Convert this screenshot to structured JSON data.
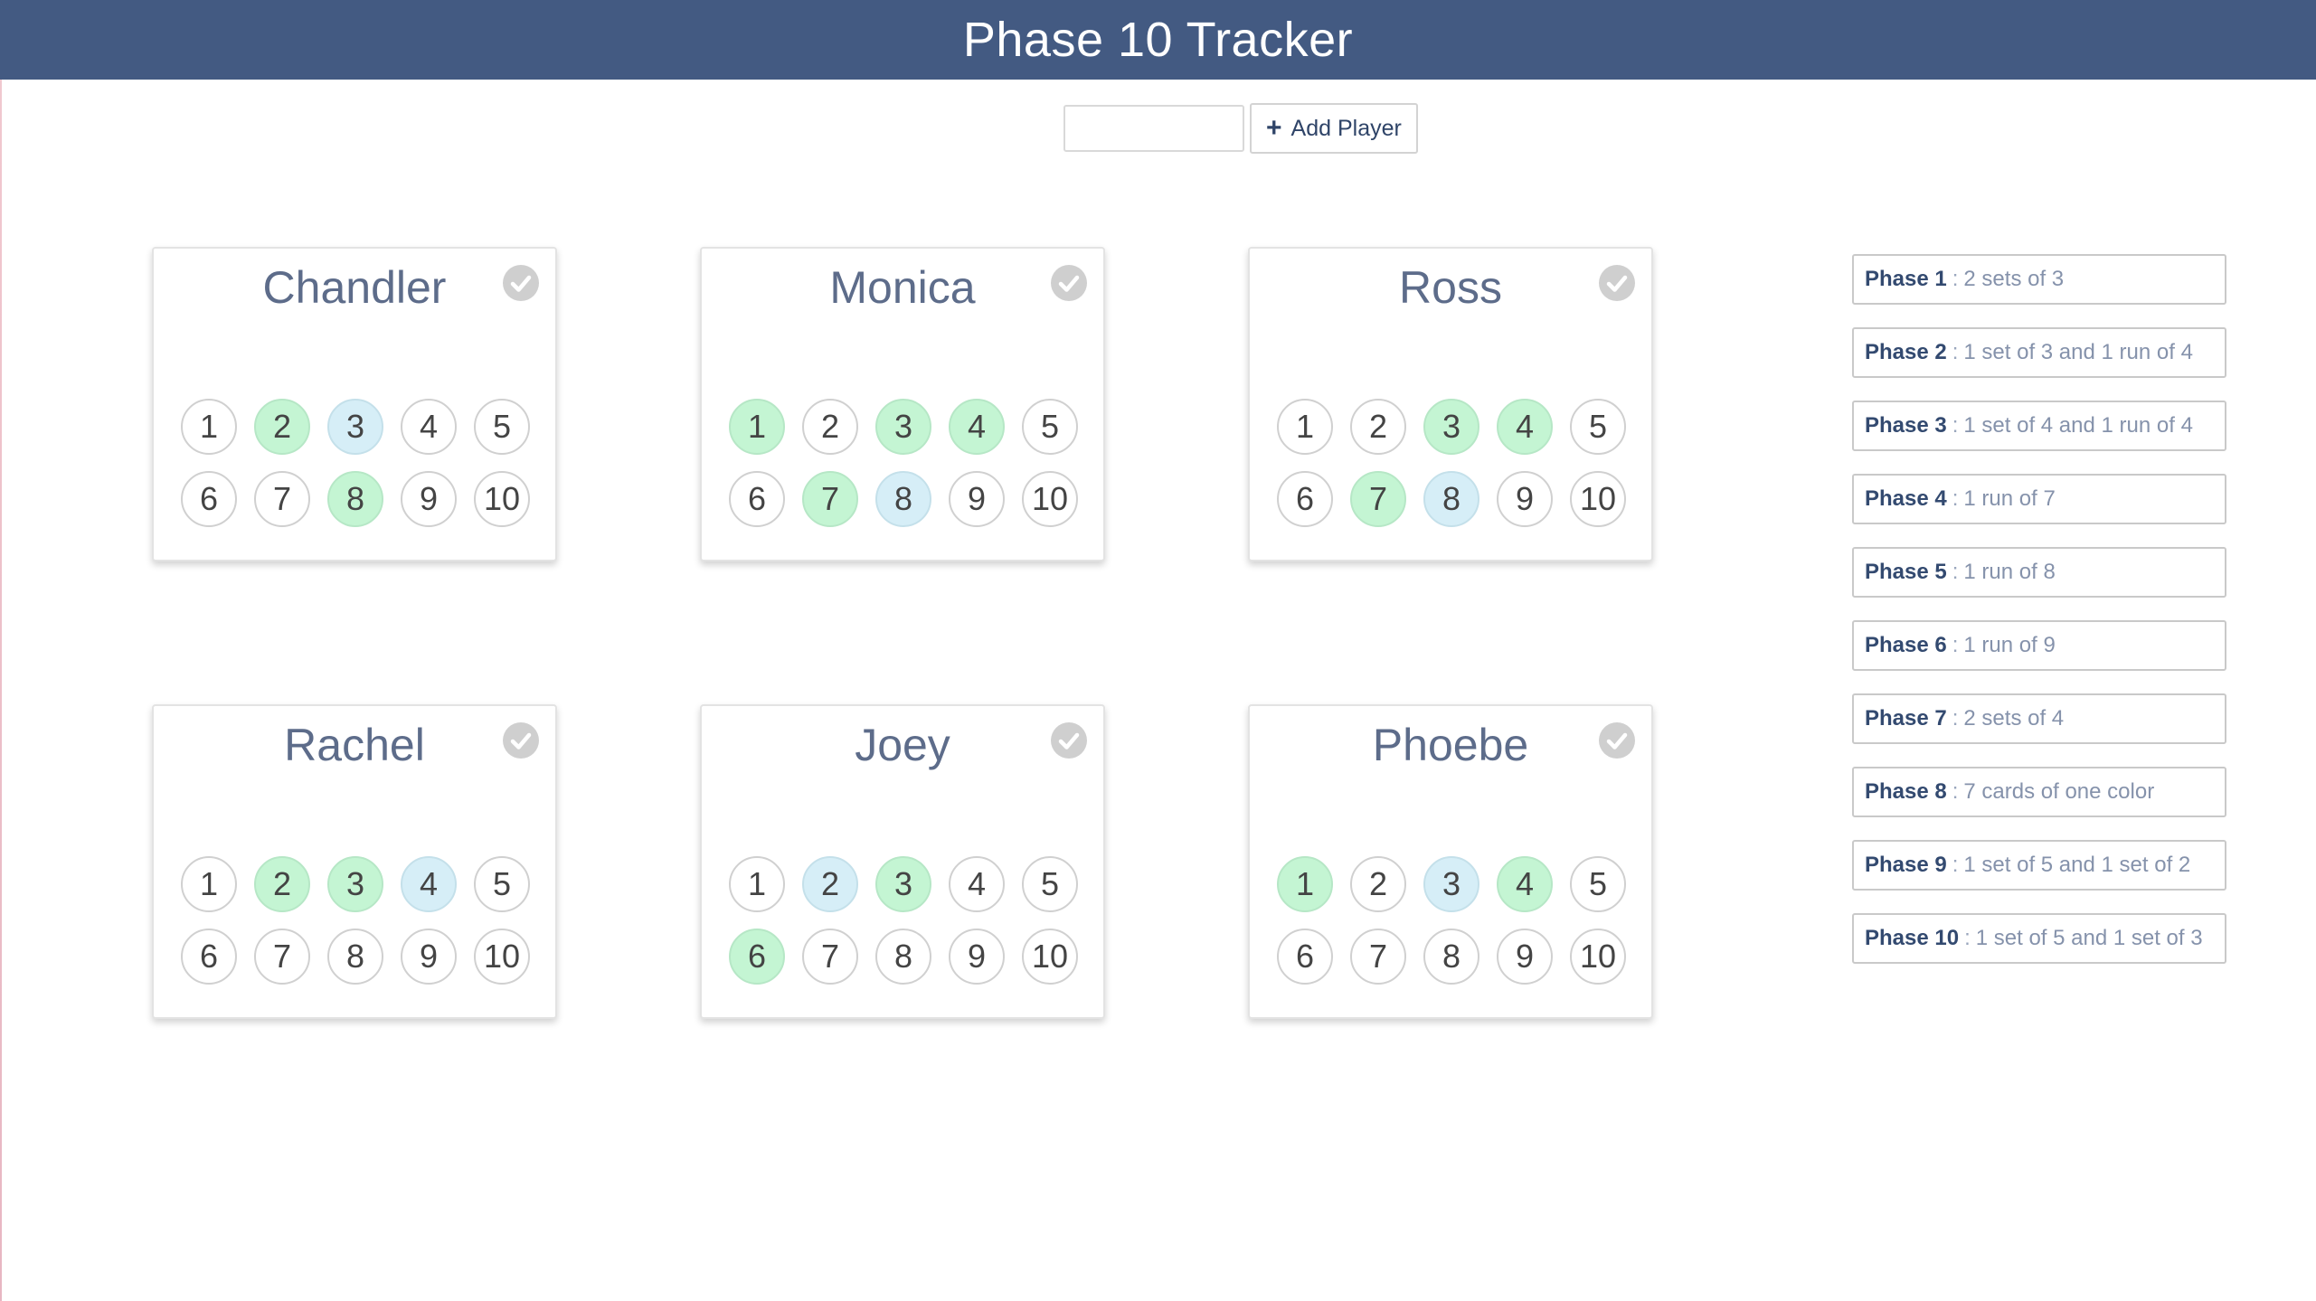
{
  "app": {
    "title": "Phase 10 Tracker"
  },
  "add_player": {
    "input_value": "",
    "input_placeholder": "",
    "button_label": "Add Player",
    "button_icon": "plus-icon"
  },
  "colors": {
    "header": "#435a82",
    "completed_phase": "#c4f5d3",
    "current_phase": "#d6eef7"
  },
  "players": [
    {
      "name": "Chandler",
      "completed": [
        2,
        8
      ],
      "current": [
        3
      ]
    },
    {
      "name": "Monica",
      "completed": [
        1,
        3,
        4,
        7
      ],
      "current": [
        8
      ]
    },
    {
      "name": "Ross",
      "completed": [
        3,
        4,
        7
      ],
      "current": [
        8
      ]
    },
    {
      "name": "Rachel",
      "completed": [
        2,
        3
      ],
      "current": [
        4
      ]
    },
    {
      "name": "Joey",
      "completed": [
        3,
        6
      ],
      "current": [
        2
      ]
    },
    {
      "name": "Phoebe",
      "completed": [
        1,
        4
      ],
      "current": [
        3
      ]
    }
  ],
  "phase_numbers": [
    "1",
    "2",
    "3",
    "4",
    "5",
    "6",
    "7",
    "8",
    "9",
    "10"
  ],
  "phases": [
    {
      "name": "Phase 1",
      "separator": ":",
      "description": "2 sets of 3"
    },
    {
      "name": "Phase 2",
      "separator": ":",
      "description": "1 set of 3 and 1 run of 4"
    },
    {
      "name": "Phase 3",
      "separator": ":",
      "description": "1 set of 4 and 1 run of 4"
    },
    {
      "name": "Phase 4",
      "separator": ":",
      "description": "1 run of 7"
    },
    {
      "name": "Phase 5",
      "separator": ":",
      "description": "1 run of 8"
    },
    {
      "name": "Phase 6",
      "separator": ":",
      "description": "1 run of 9"
    },
    {
      "name": "Phase 7",
      "separator": ":",
      "description": "2 sets of 4"
    },
    {
      "name": "Phase 8",
      "separator": ":",
      "description": "7 cards of one color"
    },
    {
      "name": "Phase 9",
      "separator": ":",
      "description": "1 set of 5 and 1 set of 2"
    },
    {
      "name": "Phase 10",
      "separator": ":",
      "description": "1 set of 5 and 1 set of 3"
    }
  ]
}
